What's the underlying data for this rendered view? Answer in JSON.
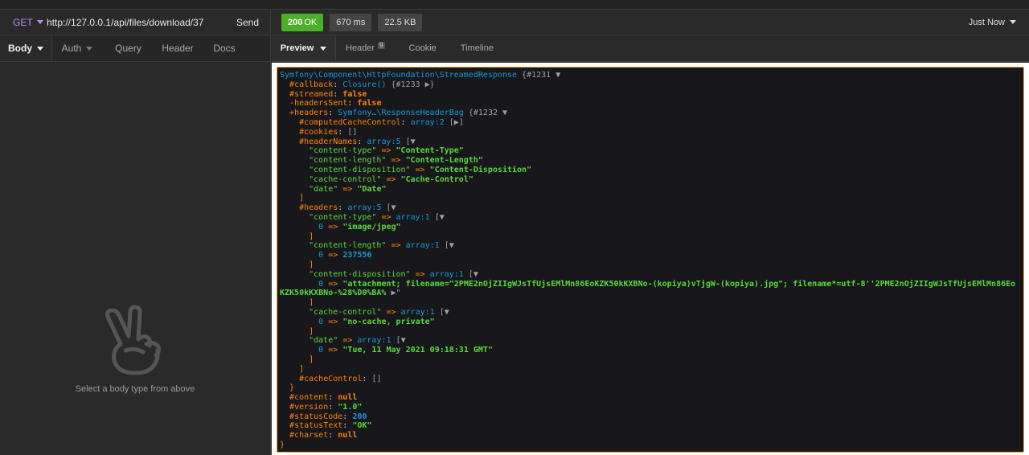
{
  "request": {
    "method": "GET",
    "url": "http://127.0.0.1/api/files/download/37",
    "send_label": "Send",
    "tabs": [
      {
        "label": "Body"
      },
      {
        "label": "Auth"
      },
      {
        "label": "Query"
      },
      {
        "label": "Header"
      },
      {
        "label": "Docs"
      }
    ],
    "empty_hint": "Select a body type from above"
  },
  "response": {
    "status_code": "200",
    "status_text": "OK",
    "time": "670 ms",
    "size": "22.5 KB",
    "timestamp": "Just Now",
    "tabs": [
      {
        "label": "Preview"
      },
      {
        "label": "Header",
        "count": "9"
      },
      {
        "label": "Cookie"
      },
      {
        "label": "Timeline"
      }
    ]
  },
  "dump": {
    "l1_class": "Symfony\\Component\\HttpFoundation\\StreamedResponse",
    "l1_ref": "{#1231 ▼",
    "l2_key": "#callback",
    "l2_val": "Closure()",
    "l2_ref": "{#1233 ▶}",
    "l3_key": "#streamed",
    "l3_val": "false",
    "l4_key": "-headersSent",
    "l4_val": "false",
    "l5_key": "+headers",
    "l5_val": "Symfony…\\ResponseHeaderBag",
    "l5_ref": "{#1232 ▼",
    "l6_key": "#computedCacheControl",
    "l6_val": "array:2",
    "l6_ref": "[▶]",
    "l7_key": "#cookies",
    "l7_val": "[]",
    "l8_key": "#headerNames",
    "l8_val": "array:5",
    "l8_ref": "[▼",
    "hn1_k": "\"content-type\"",
    "hn1_v": "\"Content-Type\"",
    "hn2_k": "\"content-length\"",
    "hn2_v": "\"Content-Length\"",
    "hn3_k": "\"content-disposition\"",
    "hn3_v": "\"Content-Disposition\"",
    "hn4_k": "\"cache-control\"",
    "hn4_v": "\"Cache-Control\"",
    "hn5_k": "\"date\"",
    "hn5_v": "\"Date\"",
    "close_bracket": "]",
    "l9_key": "#headers",
    "l9_val": "array:5",
    "l9_ref": "[▼",
    "h1_k": "\"content-type\"",
    "h1_arr": "array:1",
    "h1_ref": "[▼",
    "h1_idx": "0",
    "h1_v": "\"image/jpeg\"",
    "h2_k": "\"content-length\"",
    "h2_arr": "array:1",
    "h2_ref": "[▼",
    "h2_idx": "0",
    "h2_v": "237556",
    "h3_k": "\"content-disposition\"",
    "h3_arr": "array:1",
    "h3_ref": "[▼",
    "h3_idx": "0",
    "h3_v1": "\"attachment; filename=\"2PME2nOjZIIgWJsTfUjsEMlMn86EoKZK50kKXBNo-(kopiya)vTjgW-(kopiya).jpg\"; filename*=utf-8''2PME2nOjZIIgWJsTfUjsEMlMn86Eo",
    "h3_v2": "KZK50kKXBNo-%28%D0%BA%",
    "h3_more": "▶\"",
    "h4_k": "\"cache-control\"",
    "h4_arr": "array:1",
    "h4_ref": "[▼",
    "h4_idx": "0",
    "h4_v": "\"no-cache, private\"",
    "h5_k": "\"date\"",
    "h5_arr": "array:1",
    "h5_ref": "[▼",
    "h5_idx": "0",
    "h5_v": "\"Tue, 11 May 2021 09:18:31 GMT\"",
    "l10_key": "#cacheControl",
    "l10_val": "[]",
    "close_brace": "}",
    "l11_key": "#content",
    "l11_val": "null",
    "l12_key": "#version",
    "l12_val": "\"1.0\"",
    "l13_key": "#statusCode",
    "l13_val": "200",
    "l14_key": "#statusText",
    "l14_val": "\"OK\"",
    "l15_key": "#charset",
    "l15_val": "null",
    "arrow": "=>",
    "colon": ":"
  }
}
